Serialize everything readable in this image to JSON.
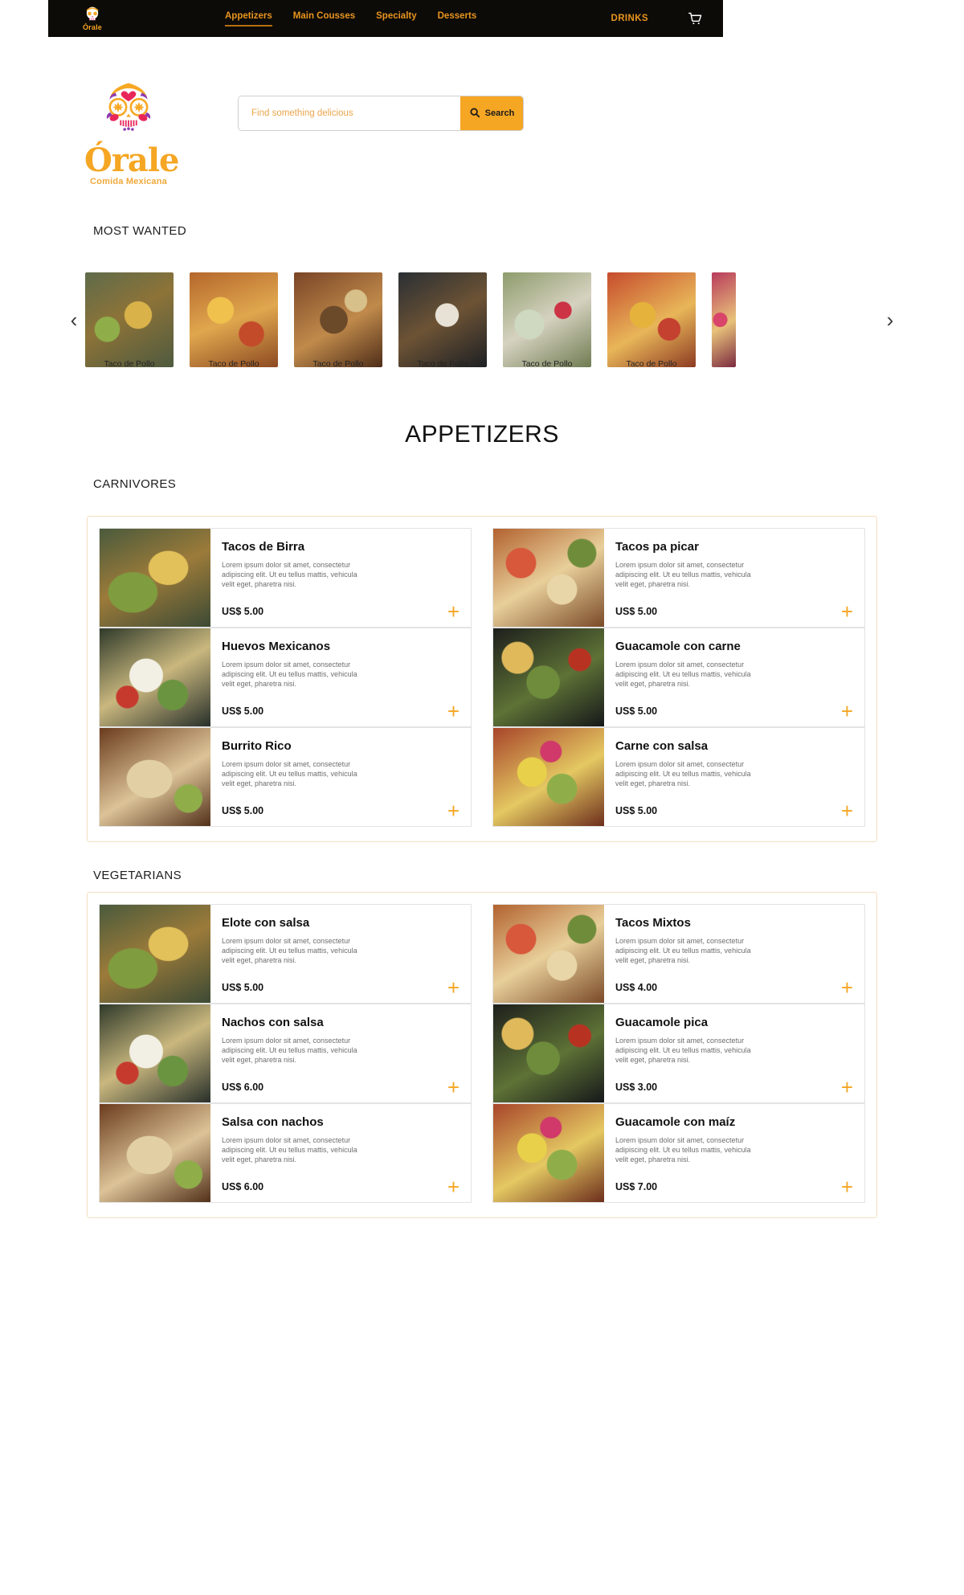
{
  "nav": {
    "logo_text": "Órale",
    "links": [
      {
        "label": "Appetizers",
        "active": true
      },
      {
        "label": "Main Cousses",
        "active": false
      },
      {
        "label": "Specialty",
        "active": false
      },
      {
        "label": "Desserts",
        "active": false
      }
    ],
    "drinks_label": "DRINKS",
    "cart_icon": "shopping-cart-icon"
  },
  "brand": {
    "name": "Órale",
    "tagline": "Comida Mexicana",
    "logo_icon": "sugar-skull-icon"
  },
  "search": {
    "placeholder": "Find something delicious",
    "value": "",
    "button_label": "Search",
    "button_icon": "search-icon"
  },
  "most_wanted": {
    "title": "MOST WANTED",
    "prev_icon": "chevron-left-icon",
    "next_icon": "chevron-right-icon",
    "items": [
      {
        "caption": "Taco de Pollo",
        "art": "f0"
      },
      {
        "caption": "Taco de Pollo",
        "art": "f1"
      },
      {
        "caption": "Taco de Pollo",
        "art": "f2"
      },
      {
        "caption": "Taco de Pollo",
        "art": "f3"
      },
      {
        "caption": "Taco de Pollo",
        "art": "f4"
      },
      {
        "caption": "Taco de Pollo",
        "art": "f5"
      },
      {
        "caption": "",
        "art": "f6"
      }
    ]
  },
  "appetizers": {
    "title": "APPETIZERS",
    "sections": [
      {
        "title": "CARNIVORES",
        "items": [
          {
            "name": "Tacos de Birra",
            "desc": "Lorem ipsum dolor sit amet, consectetur adipiscing elit. Ut eu tellus mattis, vehicula velit eget, pharetra nisi.",
            "price": "US$ 5.00",
            "art": "g-tacos",
            "add_icon": "plus-icon"
          },
          {
            "name": "Tacos pa picar",
            "desc": "Lorem ipsum dolor sit amet, consectetur adipiscing elit. Ut eu tellus mattis, vehicula velit eget, pharetra nisi.",
            "price": "US$ 5.00",
            "art": "g-picar",
            "add_icon": "plus-icon"
          },
          {
            "name": "Huevos Mexicanos",
            "desc": "Lorem ipsum dolor sit amet, consectetur adipiscing elit. Ut eu tellus mattis, vehicula velit eget, pharetra nisi.",
            "price": "US$ 5.00",
            "art": "g-huevos",
            "add_icon": "plus-icon"
          },
          {
            "name": "Guacamole con carne",
            "desc": "Lorem ipsum dolor sit amet, consectetur adipiscing elit. Ut eu tellus mattis, vehicula velit eget, pharetra nisi.",
            "price": "US$ 5.00",
            "art": "g-guac",
            "add_icon": "plus-icon"
          },
          {
            "name": "Burrito Rico",
            "desc": "Lorem ipsum dolor sit amet, consectetur adipiscing elit. Ut eu tellus mattis, vehicula velit eget, pharetra nisi.",
            "price": "US$ 5.00",
            "art": "g-burrito",
            "add_icon": "plus-icon"
          },
          {
            "name": "Carne con salsa",
            "desc": "Lorem ipsum dolor sit amet, consectetur adipiscing elit. Ut eu tellus mattis, vehicula velit eget, pharetra nisi.",
            "price": "US$ 5.00",
            "art": "g-carne",
            "add_icon": "plus-icon"
          }
        ]
      },
      {
        "title": "VEGETARIANS",
        "items": [
          {
            "name": "Elote con salsa",
            "desc": "Lorem ipsum dolor sit amet, consectetur adipiscing elit. Ut eu tellus mattis, vehicula velit eget, pharetra nisi.",
            "price": "US$ 5.00",
            "art": "g-tacos",
            "add_icon": "plus-icon"
          },
          {
            "name": "Tacos Mixtos",
            "desc": "Lorem ipsum dolor sit amet, consectetur adipiscing elit. Ut eu tellus mattis, vehicula velit eget, pharetra nisi.",
            "price": "US$ 4.00",
            "art": "g-picar",
            "add_icon": "plus-icon"
          },
          {
            "name": "Nachos con salsa",
            "desc": "Lorem ipsum dolor sit amet, consectetur adipiscing elit. Ut eu tellus mattis, vehicula velit eget, pharetra nisi.",
            "price": "US$ 6.00",
            "art": "g-huevos",
            "add_icon": "plus-icon"
          },
          {
            "name": "Guacamole pica",
            "desc": "Lorem ipsum dolor sit amet, consectetur adipiscing elit. Ut eu tellus mattis, vehicula velit eget, pharetra nisi.",
            "price": "US$ 3.00",
            "art": "g-guac",
            "add_icon": "plus-icon"
          },
          {
            "name": "Salsa con nachos",
            "desc": "Lorem ipsum dolor sit amet, consectetur adipiscing elit. Ut eu tellus mattis, vehicula velit eget, pharetra nisi.",
            "price": "US$ 6.00",
            "art": "g-burrito",
            "add_icon": "plus-icon"
          },
          {
            "name": "Guacamole con maíz",
            "desc": "Lorem ipsum dolor sit amet, consectetur adipiscing elit. Ut eu tellus mattis, vehicula velit eget, pharetra nisi.",
            "price": "US$ 7.00",
            "art": "g-carne",
            "add_icon": "plus-icon"
          }
        ]
      }
    ]
  },
  "colors": {
    "accent": "#f5a623",
    "nav_bg": "#0d0b08",
    "nav_link": "#e8941f",
    "card_border": "#e3e3e3",
    "box_border": "#f3dfc0"
  }
}
